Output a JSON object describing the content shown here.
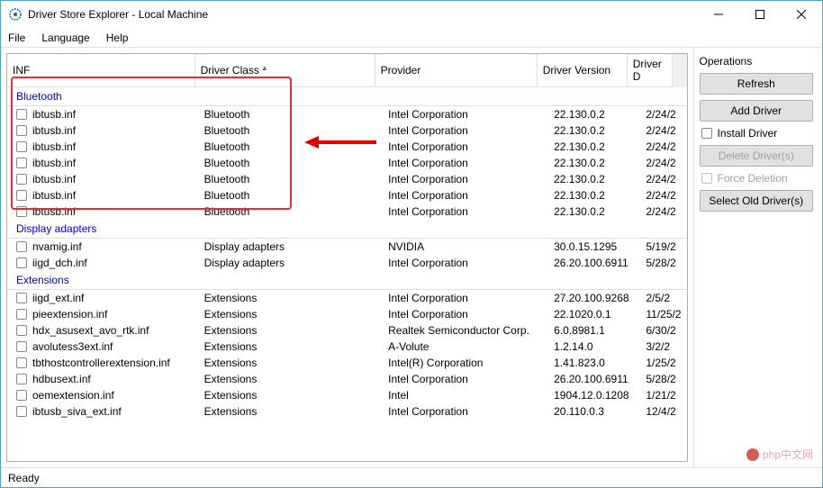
{
  "window": {
    "title": "Driver Store Explorer - Local Machine"
  },
  "menu": {
    "file": "File",
    "language": "Language",
    "help": "Help"
  },
  "columns": {
    "inf": "INF",
    "driver_class": "Driver Class",
    "provider": "Provider",
    "driver_version": "Driver Version",
    "driver_d": "Driver D"
  },
  "groups": [
    {
      "name": "Bluetooth",
      "rows": [
        {
          "inf": "ibtusb.inf",
          "class": "Bluetooth",
          "provider": "Intel Corporation",
          "version": "22.130.0.2",
          "date": "2/24/2"
        },
        {
          "inf": "ibtusb.inf",
          "class": "Bluetooth",
          "provider": "Intel Corporation",
          "version": "22.130.0.2",
          "date": "2/24/2"
        },
        {
          "inf": "ibtusb.inf",
          "class": "Bluetooth",
          "provider": "Intel Corporation",
          "version": "22.130.0.2",
          "date": "2/24/2"
        },
        {
          "inf": "ibtusb.inf",
          "class": "Bluetooth",
          "provider": "Intel Corporation",
          "version": "22.130.0.2",
          "date": "2/24/2"
        },
        {
          "inf": "ibtusb.inf",
          "class": "Bluetooth",
          "provider": "Intel Corporation",
          "version": "22.130.0.2",
          "date": "2/24/2"
        },
        {
          "inf": "ibtusb.inf",
          "class": "Bluetooth",
          "provider": "Intel Corporation",
          "version": "22.130.0.2",
          "date": "2/24/2"
        },
        {
          "inf": "ibtusb.inf",
          "class": "Bluetooth",
          "provider": "Intel Corporation",
          "version": "22.130.0.2",
          "date": "2/24/2"
        }
      ]
    },
    {
      "name": "Display adapters",
      "rows": [
        {
          "inf": "nvamig.inf",
          "class": "Display adapters",
          "provider": "NVIDIA",
          "version": "30.0.15.1295",
          "date": "5/19/2"
        },
        {
          "inf": "iigd_dch.inf",
          "class": "Display adapters",
          "provider": "Intel Corporation",
          "version": "26.20.100.6911",
          "date": "5/28/2"
        }
      ]
    },
    {
      "name": "Extensions",
      "rows": [
        {
          "inf": "iigd_ext.inf",
          "class": "Extensions",
          "provider": "Intel Corporation",
          "version": "27.20.100.9268",
          "date": "2/5/2"
        },
        {
          "inf": "pieextension.inf",
          "class": "Extensions",
          "provider": "Intel Corporation",
          "version": "22.1020.0.1",
          "date": "11/25/2"
        },
        {
          "inf": "hdx_asusext_avo_rtk.inf",
          "class": "Extensions",
          "provider": "Realtek Semiconductor Corp.",
          "version": "6.0.8981.1",
          "date": "6/30/2"
        },
        {
          "inf": "avolutess3ext.inf",
          "class": "Extensions",
          "provider": "A-Volute",
          "version": "1.2.14.0",
          "date": "3/2/2"
        },
        {
          "inf": "tbthostcontrollerextension.inf",
          "class": "Extensions",
          "provider": "Intel(R) Corporation",
          "version": "1.41.823.0",
          "date": "1/25/2"
        },
        {
          "inf": "hdbusext.inf",
          "class": "Extensions",
          "provider": "Intel Corporation",
          "version": "26.20.100.6911",
          "date": "5/28/2"
        },
        {
          "inf": "oemextension.inf",
          "class": "Extensions",
          "provider": "Intel",
          "version": "1904.12.0.1208",
          "date": "1/21/2"
        },
        {
          "inf": "ibtusb_siva_ext.inf",
          "class": "Extensions",
          "provider": "Intel Corporation",
          "version": "20.110.0.3",
          "date": "12/4/2"
        }
      ]
    }
  ],
  "side": {
    "title": "Operations",
    "refresh": "Refresh",
    "add": "Add Driver",
    "install": "Install Driver",
    "delete": "Delete Driver(s)",
    "force": "Force Deletion",
    "select_old": "Select Old Driver(s)"
  },
  "status": "Ready",
  "watermark": "php中文网"
}
